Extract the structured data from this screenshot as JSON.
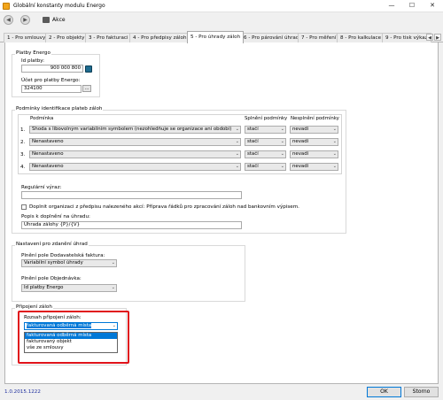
{
  "window": {
    "title": "Globální konstanty modulu Energo",
    "minimize": "—",
    "maximize": "☐",
    "close": "✕"
  },
  "toolbar": {
    "back_icon": "arrow-left",
    "forward_icon": "arrow-right",
    "actions_label": "Akce"
  },
  "tabs": [
    {
      "label": "1 - Pro smlouvy",
      "active": false
    },
    {
      "label": "2 - Pro objekty",
      "active": false
    },
    {
      "label": "3 - Pro fakturaci",
      "active": false
    },
    {
      "label": "4 - Pro předpisy záloh",
      "active": false
    },
    {
      "label": "5 - Pro úhrady záloh",
      "active": true
    },
    {
      "label": "6 - Pro párování úhrad",
      "active": false
    },
    {
      "label": "7 - Pro měření",
      "active": false
    },
    {
      "label": "8 - Pro kalkulace",
      "active": false
    },
    {
      "label": "9 - Pro tisk výkaz",
      "active": false
    }
  ],
  "tab_scroll": {
    "left": "◀",
    "right": "▶"
  },
  "platby": {
    "group_label": "Platby Energo",
    "id_label": "Id platby:",
    "id_value": "900 000 800",
    "ucet_label": "Účet pro platby Energo:",
    "ucet_value": "324100",
    "ucet_button": "..."
  },
  "podminky": {
    "group_label": "Podmínky identifikace plateb záloh",
    "col_podminka": "Podmínka",
    "col_splneni": "Splnění podmínky",
    "col_nesplneni": "Nesplnění podmínky",
    "rows": [
      {
        "num": "1.",
        "condition": "Shoda s libovolným variabilním symbolem (nezohledňuje se organizace ani období)",
        "met": "stačí",
        "not_met": "nevadí"
      },
      {
        "num": "2.",
        "condition": "Nenastaveno",
        "met": "stačí",
        "not_met": "nevadí"
      },
      {
        "num": "3.",
        "condition": "Nenastaveno",
        "met": "stačí",
        "not_met": "nevadí"
      },
      {
        "num": "4.",
        "condition": "Nenastaveno",
        "met": "stačí",
        "not_met": "nevadí"
      }
    ],
    "regex_label": "Regulární výraz:",
    "regex_value": "",
    "checkbox_label": "Doplnit organizaci z předpisu nalezeného akcí: Příprava řádků pro zpracování záloh nad bankovním výpisem.",
    "checkbox_checked": false,
    "popis_label": "Popis k doplnění na úhradu:",
    "popis_value": "Úhrada zálohy {P}/{V}"
  },
  "nastaveni": {
    "group_label": "Nastavení pro zdanění úhrad",
    "dodavatelska_label": "Plnění pole Dodavatelská faktura:",
    "dodavatelska_value": "Variabilní symbol úhrady",
    "objednavka_label": "Plnění pole Objednávka:",
    "objednavka_value": "Id platby Energo"
  },
  "pripojeni": {
    "group_label": "Připojení záloh",
    "rozsah_label": "Rozsah připojení záloh:",
    "rozsah_value": "fakturovaná odběrná místa",
    "options": [
      {
        "label": "fakturovaná odběrná místa",
        "selected": true
      },
      {
        "label": "fakturovaný objekt",
        "selected": false
      },
      {
        "label": "vše ze smlouvy",
        "selected": false
      }
    ]
  },
  "footer": {
    "version": "1.0.2015.1222",
    "ok_label": "OK",
    "cancel_label": "Storno"
  },
  "colors": {
    "accent": "#0078d7",
    "highlight": "#e0131b",
    "version_text": "#1f2f9e"
  }
}
